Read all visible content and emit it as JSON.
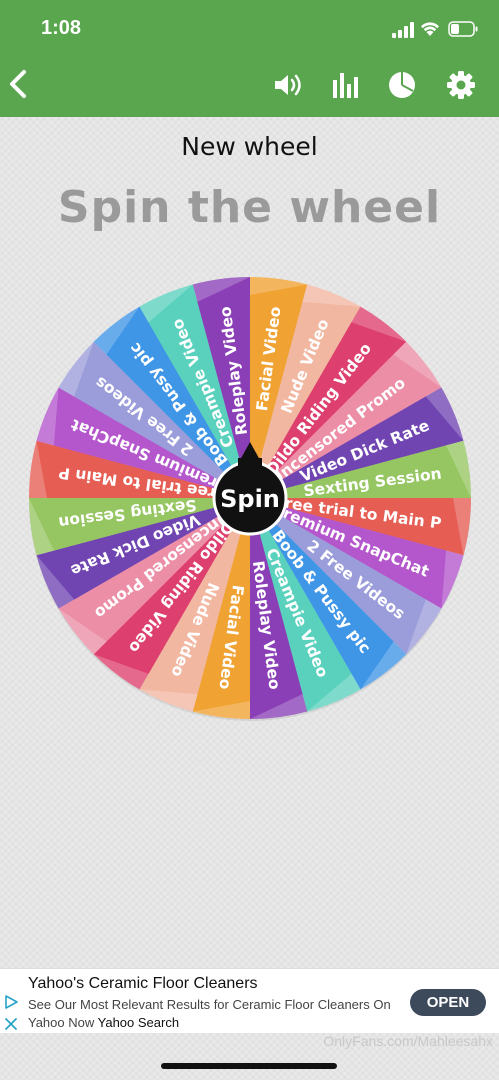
{
  "status_bar": {
    "time": "1:08"
  },
  "header": {
    "back_icon": "chevron-left-icon",
    "icons": [
      "volume-icon",
      "bar-chart-icon",
      "pie-chart-icon",
      "gear-icon"
    ]
  },
  "title": "New wheel",
  "subtitle": "Spin the wheel",
  "wheel": {
    "center_label": "Spin",
    "segments": [
      {
        "label": "Facial Video",
        "color": "#f0a232"
      },
      {
        "label": "Nude Video",
        "color": "#f2b7a0"
      },
      {
        "label": "Dildo Riding Video",
        "color": "#dd3f6e"
      },
      {
        "label": "Uncensored Promo",
        "color": "#ec8ea6"
      },
      {
        "label": "Video Dick Rate",
        "color": "#7045b2"
      },
      {
        "label": "Sexting Session",
        "color": "#96c662"
      },
      {
        "label": "Free trial to Main P",
        "color": "#e65d54"
      },
      {
        "label": "Premium SnapChat",
        "color": "#b456cc"
      },
      {
        "label": "2 Free Videos",
        "color": "#9b9dda"
      },
      {
        "label": "Boob & Pussy pic",
        "color": "#3f95e6"
      },
      {
        "label": "Creampie Video",
        "color": "#5ad1bd"
      },
      {
        "label": "Roleplay Video",
        "color": "#8a3fb6"
      },
      {
        "label": "Facial Video",
        "color": "#f0a232"
      },
      {
        "label": "Nude Video",
        "color": "#f2b7a0"
      },
      {
        "label": "Dildo Riding Video",
        "color": "#dd3f6e"
      },
      {
        "label": "Uncensored Promo",
        "color": "#ec8ea6"
      },
      {
        "label": "Video Dick Rate",
        "color": "#7045b2"
      },
      {
        "label": "Sexting Session",
        "color": "#96c662"
      },
      {
        "label": "Free trial to Main P",
        "color": "#e65d54"
      },
      {
        "label": "Premium SnapChat",
        "color": "#b456cc"
      },
      {
        "label": "2 Free Videos",
        "color": "#9b9dda"
      },
      {
        "label": "Boob & Pussy pic",
        "color": "#3f95e6"
      },
      {
        "label": "Creampie Video",
        "color": "#5ad1bd"
      },
      {
        "label": "Roleplay Video",
        "color": "#8a3fb6"
      }
    ]
  },
  "ad": {
    "title": "Yahoo's Ceramic Floor Cleaners",
    "body": "See Our Most Relevant Results for Ceramic Floor Cleaners On Yahoo Now",
    "source": "Yahoo Search",
    "cta": "OPEN"
  },
  "watermark": "OnlyFans.com/Mahleesahx",
  "colors": {
    "header": "#5aa64f",
    "background": "#e9e9e9",
    "ad_button": "#3c4a5c"
  }
}
